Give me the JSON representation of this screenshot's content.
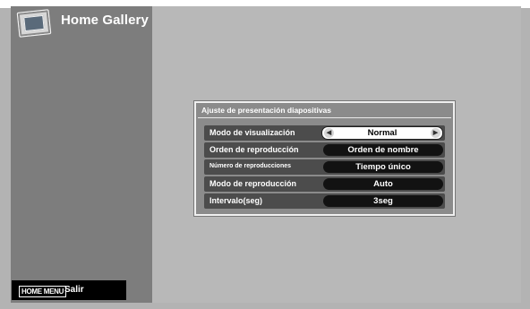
{
  "app": {
    "title": "Home Gallery",
    "icon": "picture-frame-icon"
  },
  "dialog": {
    "title": "Ajuste de presentación diapositivas",
    "rows": [
      {
        "label": "Modo de visualización",
        "value": "Normal"
      },
      {
        "label": "Orden de reproducción",
        "value": "Orden de nombre"
      },
      {
        "label": "Número de reproducciones",
        "value": "Tiempo único"
      },
      {
        "label": "Modo de reproducción",
        "value": "Auto"
      },
      {
        "label": "Intervalo(seg)",
        "value": "3seg"
      }
    ]
  },
  "footer": {
    "menu_key": "HOME MENU",
    "exit_label": "Salir"
  },
  "colors": {
    "background": "#b3b3b3",
    "sidebar": "#7d7d7d",
    "dialog": "#8b8b8b",
    "row": "#4c4c4c",
    "value_pill": "#121212",
    "selected_pill": "#ffffff"
  }
}
